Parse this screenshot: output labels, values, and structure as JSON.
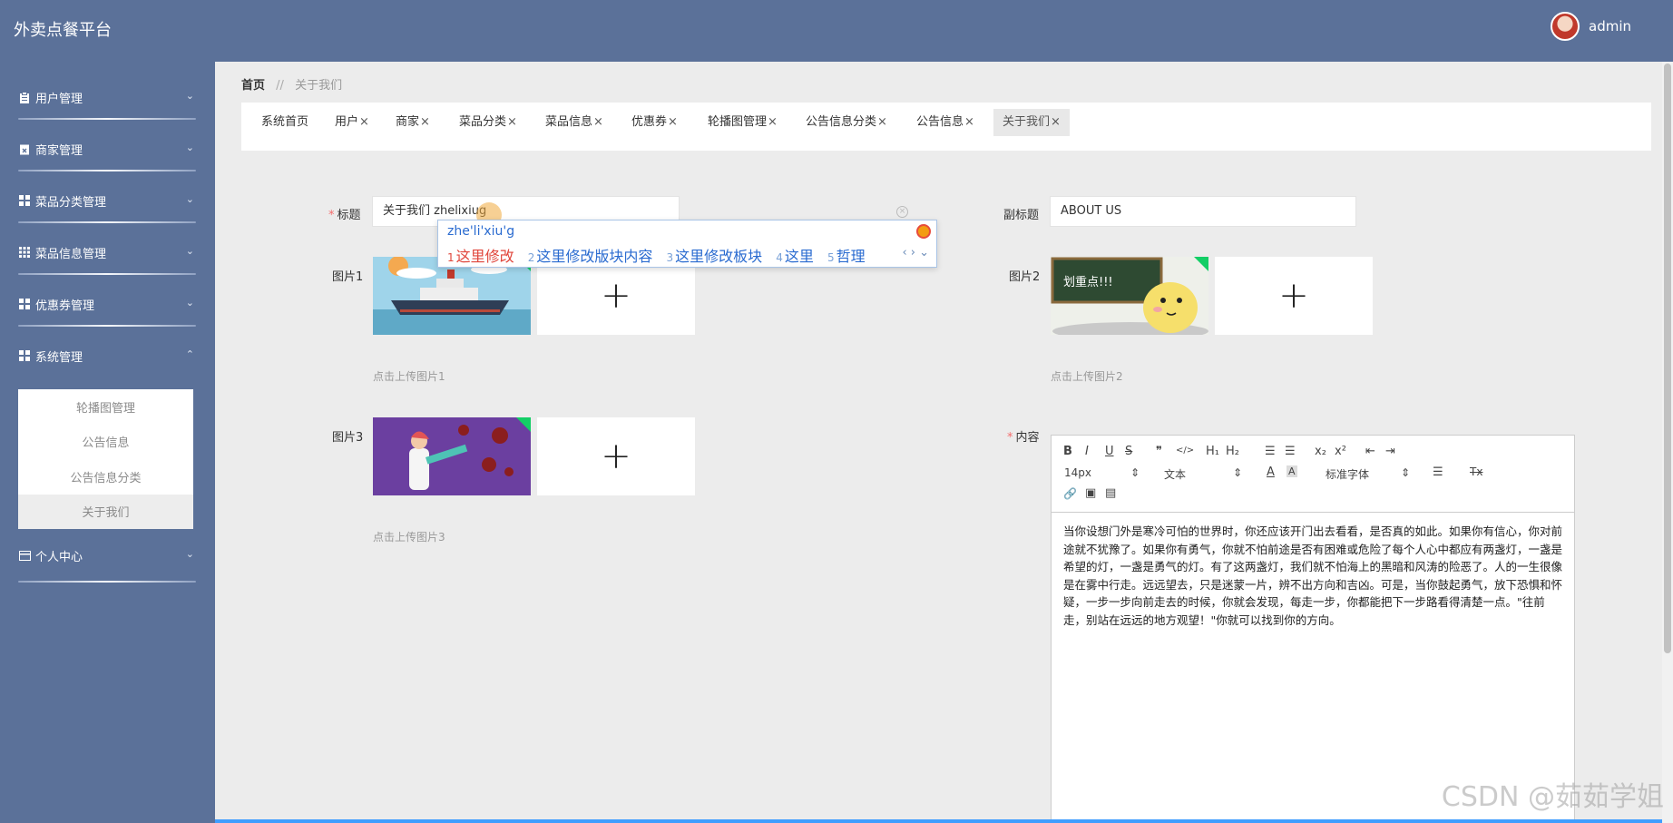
{
  "app": {
    "title": "外卖点餐平台",
    "user": "admin"
  },
  "sidebar": {
    "items": [
      {
        "label": "用户管理",
        "icon": "clipboard-icon",
        "chevron": "⌄"
      },
      {
        "label": "商家管理",
        "icon": "calendar-x-icon",
        "chevron": "⌄"
      },
      {
        "label": "菜品分类管理",
        "icon": "grid-icon",
        "chevron": "⌄"
      },
      {
        "label": "菜品信息管理",
        "icon": "grid-icon",
        "chevron": "⌄"
      },
      {
        "label": "优惠券管理",
        "icon": "grid-icon",
        "chevron": "⌄"
      },
      {
        "label": "系统管理",
        "icon": "grid-icon",
        "chevron": "⌃"
      },
      {
        "label": "个人中心",
        "icon": "card-icon",
        "chevron": "⌄"
      }
    ],
    "submenu": [
      "轮播图管理",
      "公告信息",
      "公告信息分类",
      "关于我们"
    ]
  },
  "breadcrumb": {
    "home": "首页",
    "sep": "//",
    "current": "关于我们"
  },
  "tabs": [
    {
      "label": "系统首页",
      "close": ""
    },
    {
      "label": "用户",
      "close": "×"
    },
    {
      "label": "商家",
      "close": "×"
    },
    {
      "label": "菜品分类",
      "close": "×"
    },
    {
      "label": "菜品信息",
      "close": "×"
    },
    {
      "label": "优惠券",
      "close": "×"
    },
    {
      "label": "轮播图管理",
      "close": "×"
    },
    {
      "label": "公告信息分类",
      "close": "×"
    },
    {
      "label": "公告信息",
      "close": "×"
    },
    {
      "label": "关于我们",
      "close": "×"
    }
  ],
  "form": {
    "required_mark": "*",
    "title_label": "标题",
    "title_value": "关于我们 zhelixiug",
    "subtitle_label": "副标题",
    "subtitle_value": "ABOUT US",
    "image1_label": "图片1",
    "image1_hint": "点击上传图片1",
    "image2_label": "图片2",
    "image2_hint": "点击上传图片2",
    "image3_label": "图片3",
    "image3_hint": "点击上传图片3",
    "content_label": "内容",
    "plus": "+"
  },
  "ime": {
    "pinyin": "zhe'li'xiu'g",
    "candidates": [
      {
        "n": "1",
        "text": "这里修改"
      },
      {
        "n": "2",
        "text": "这里修改版块内容"
      },
      {
        "n": "3",
        "text": "这里修改板块"
      },
      {
        "n": "4",
        "text": "这里"
      },
      {
        "n": "5",
        "text": "哲理"
      }
    ],
    "nav": "‹ › ⌄"
  },
  "editor": {
    "toolbar": {
      "bold": "B",
      "italic": "I",
      "underline": "U",
      "strike": "S",
      "quote": "❞",
      "code": "</>",
      "h1": "H₁",
      "h2": "H₂",
      "ol": "☰",
      "ul": "☰",
      "sub": "x₂",
      "sup": "x²",
      "outdent": "⇤",
      "indent": "⇥",
      "size": "14px",
      "header": "文本",
      "font": "标准字体",
      "color": "A",
      "bg": "A",
      "align": "☰",
      "clean": "Tx",
      "link": "🔗",
      "image": "▣",
      "video": "▤"
    },
    "content": "当你设想门外是寒冷可怕的世界时，你还应该开门出去看看，是否真的如此。如果你有信心，你对前途就不犹豫了。如果你有勇气，你就不怕前途是否有困难或危险了每个人心中都应有两盏灯，一盏是希望的灯，一盏是勇气的灯。有了这两盏灯，我们就不怕海上的黑暗和风涛的险恶了。人的一生很像是在雾中行走。远远望去，只是迷蒙一片，辨不出方向和吉凶。可是，当你鼓起勇气，放下恐惧和怀疑，一步一步向前走去的时候，你就会发现，每走一步，你都能把下一步路看得清楚一点。\"往前走，别站在远远的地方观望！\"你就可以找到你的方向。"
  },
  "watermark": "CSDN @茹茹学姐"
}
